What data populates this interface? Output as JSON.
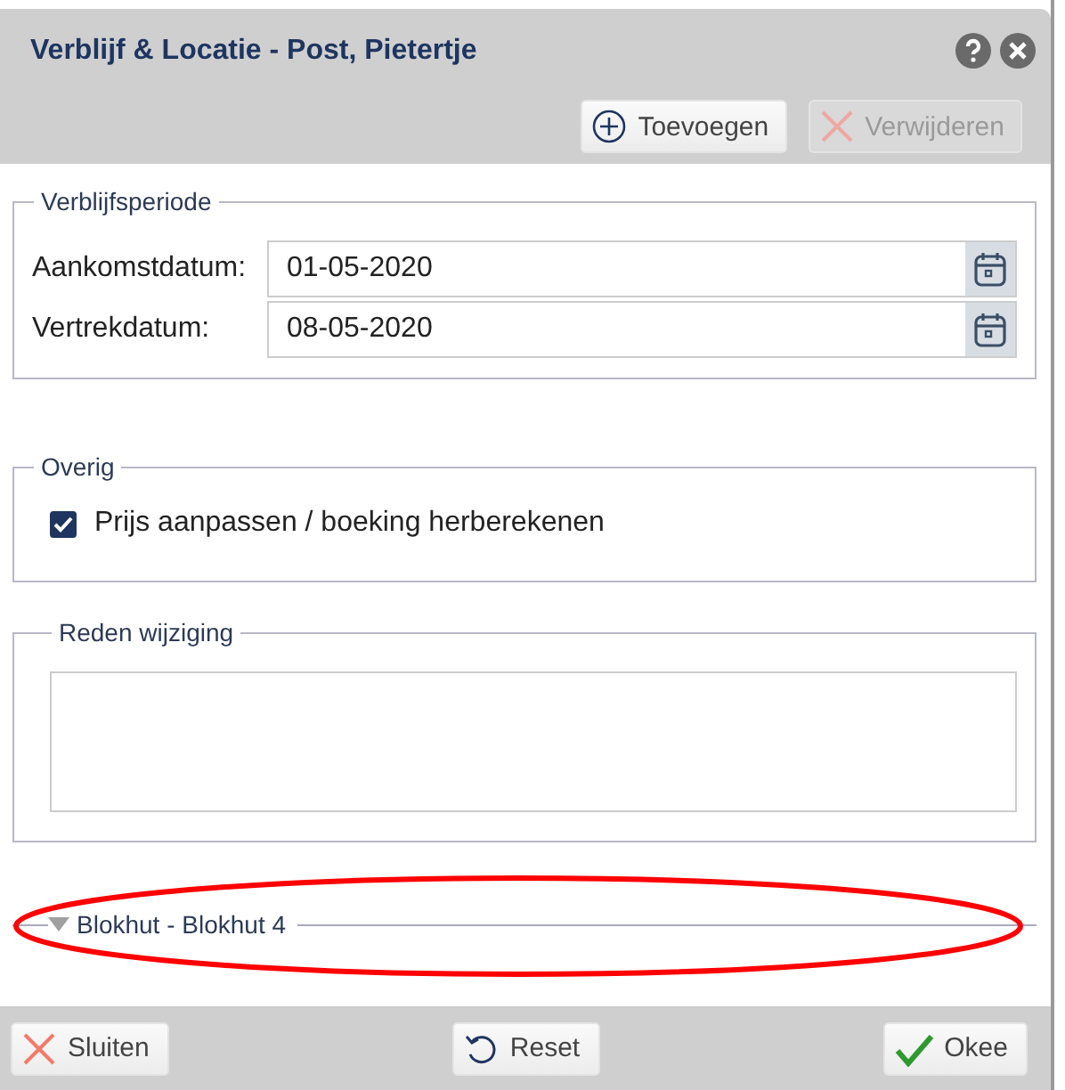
{
  "dialog": {
    "title": "Verblijf & Locatie - Post, Pietertje"
  },
  "toolbar": [
    {
      "label": "Toevoegen",
      "kind": "add",
      "disabled": false
    },
    {
      "label": "Verwijderen",
      "kind": "remove",
      "disabled": true
    }
  ],
  "period": {
    "legend": "Verblijfsperiode",
    "fields": [
      {
        "label": "Aankomstdatum:",
        "value": "01-05-2020"
      },
      {
        "label": "Vertrekdatum:",
        "value": "08-05-2020"
      }
    ]
  },
  "other": {
    "legend": "Overig",
    "checkbox": {
      "label": "Prijs aanpassen / boeking herberekenen",
      "checked": true
    }
  },
  "reason": {
    "legend": "Reden wijziging"
  },
  "group": {
    "label": "Blokhut - Blokhut 4"
  },
  "footer": [
    {
      "label": "Sluiten",
      "kind": "close"
    },
    {
      "label": "Reset",
      "kind": "reset"
    },
    {
      "label": "Okee",
      "kind": "ok"
    }
  ]
}
